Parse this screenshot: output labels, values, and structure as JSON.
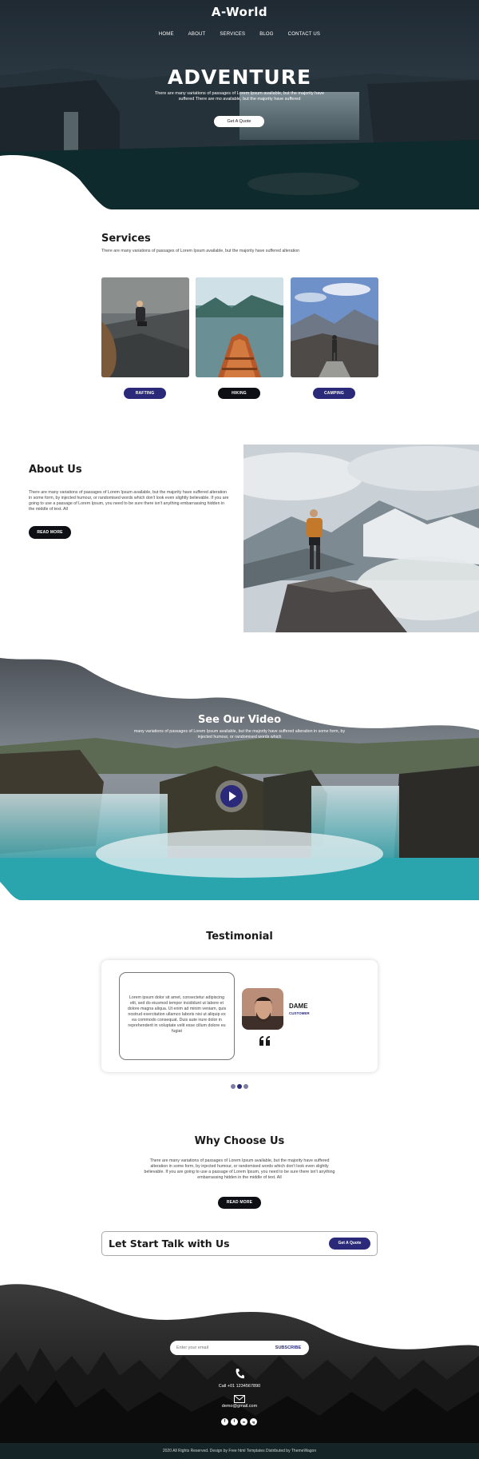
{
  "hero": {
    "logo": "A-World",
    "nav": [
      "HOME",
      "ABOUT",
      "SERVICES",
      "BLOG",
      "CONTACT US"
    ],
    "title": "ADVENTURE",
    "text": "There are many variations of passages of Lorem Ipsum available, but the majority have suffered There are mo available, but the majority have suffered",
    "button": "Get A Quote"
  },
  "services": {
    "title": "Services",
    "text": "There are many variations of passages of Lorem Ipsum available, but the majority have suffered alteration",
    "items": [
      {
        "label": "RAFTING",
        "image_icon": "hiker-on-rocks-photo"
      },
      {
        "label": "HIKING",
        "image_icon": "boat-on-lake-photo"
      },
      {
        "label": "CAMPING",
        "image_icon": "man-on-mountain-photo"
      }
    ]
  },
  "about": {
    "title": "About Us",
    "text": "There are many variations of passages of Lorem Ipsum available, but the majority have suffered alteration in some form, by injected humour, or randomised words which don't look even slightly believable. If you are going to use a passage of Lorem Ipsum, you need to be sure there isn't anything embarrassing hidden in the middle of text. All",
    "button": "READ MORE"
  },
  "video": {
    "title": "See Our Video",
    "text": "many variations of passages of Lorem Ipsum available, but the majority have suffered alteration in some form, by injected humour, or randomised words which"
  },
  "testimonial": {
    "title": "Testimonial",
    "quote": "Lorem ipsum dolor sit amet, consectetur adipiscing elit, sed do eiusmod tempor incididunt ut labore et dolore magna aliqua. Ut enim ad minim veniam, quis nostrud exercitation ullamco laboris nisi ut aliquip ex ea commodo consequat. Duis aute irure dolor in reprehenderit in voluptate velit esse cillum dolore eu fugiat",
    "name": "DAME",
    "role": "CUSTOMER"
  },
  "why": {
    "title": "Why Choose Us",
    "text": "There are many variations of passages of Lorem Ipsum available, but the majority have suffered alteration in some form, by injected humour, or randomised words which don't look even slightly believable. If you are going to use a passage of Lorem Ipsum, you need to be sure there isn't anything embarrassing hidden in the middle of text. All",
    "button": "READ MORE"
  },
  "talk": {
    "title": "Let Start Talk with Us",
    "button": "Get A Quote"
  },
  "footer": {
    "email_placeholder": "Enter your email",
    "subscribe": "SUBSCRIBE",
    "phone": "Call +01 1234567890",
    "email": "demo@gmail.com",
    "social": [
      "f",
      "t",
      "in",
      "ig"
    ],
    "copyright": "2020 All Rights Reserved. Design by Free html Templates Distributed by ThemeWagon"
  },
  "colors": {
    "accent": "#2b2a7a",
    "dark": "#0e0f14",
    "footer_bar": "#152426"
  }
}
